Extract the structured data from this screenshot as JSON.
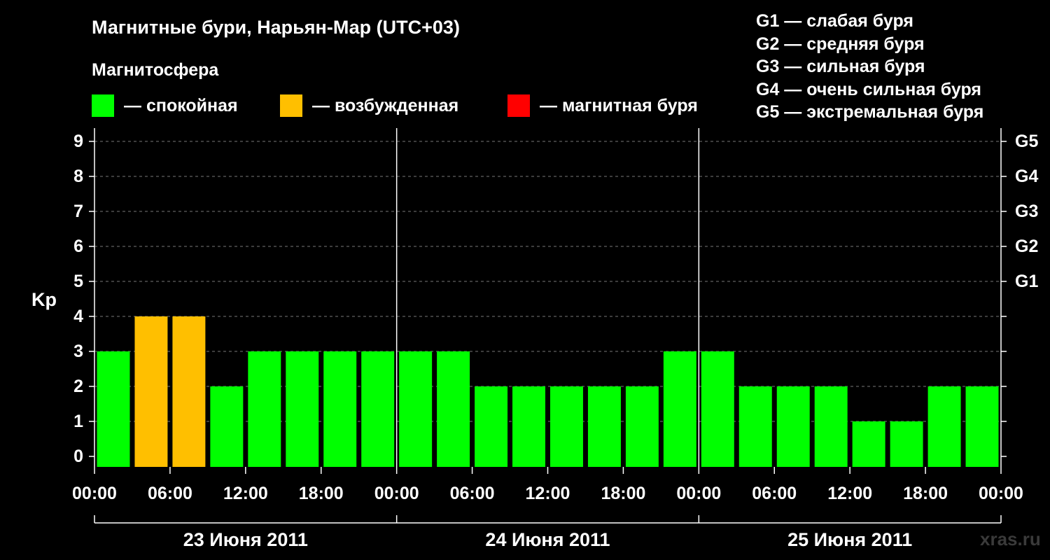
{
  "header": {
    "title": "Магнитные бури, Нарьян-Мар (UTC+03)",
    "subtitle": "Магнитосфера"
  },
  "legend": [
    {
      "label": "— спокойная",
      "color": "#00ff00"
    },
    {
      "label": "— возбужденная",
      "color": "#ffbf00"
    },
    {
      "label": "— магнитная буря",
      "color": "#ff0000"
    }
  ],
  "g_legend": [
    "G1 — слабая буря",
    "G2 — средняя буря",
    "G3 — сильная буря",
    "G4 — очень сильная буря",
    "G5 — экстремальная буря"
  ],
  "watermark": "xras.ru",
  "chart_data": {
    "type": "bar",
    "ylabel": "Kp",
    "ylim": [
      0,
      9
    ],
    "yticks": [
      "0",
      "1",
      "2",
      "3",
      "4",
      "5",
      "6",
      "7",
      "8",
      "9"
    ],
    "right_ticks": [
      {
        "kp": 5,
        "label": "G1"
      },
      {
        "kp": 6,
        "label": "G2"
      },
      {
        "kp": 7,
        "label": "G3"
      },
      {
        "kp": 8,
        "label": "G4"
      },
      {
        "kp": 9,
        "label": "G5"
      }
    ],
    "xtick_labels": [
      "00:00",
      "06:00",
      "12:00",
      "18:00",
      "00:00",
      "06:00",
      "12:00",
      "18:00",
      "00:00",
      "06:00",
      "12:00",
      "18:00",
      "00:00"
    ],
    "days": [
      "23 Июня 2011",
      "24 Июня 2011",
      "25 Июня 2011"
    ],
    "interval_hours": 3,
    "values": [
      3,
      4,
      4,
      2,
      3,
      3,
      3,
      3,
      3,
      3,
      2,
      2,
      2,
      2,
      2,
      3,
      3,
      2,
      2,
      2,
      1,
      1,
      2,
      2
    ],
    "colors": [
      "#00ff00",
      "#ffbf00",
      "#ffbf00",
      "#00ff00",
      "#00ff00",
      "#00ff00",
      "#00ff00",
      "#00ff00",
      "#00ff00",
      "#00ff00",
      "#00ff00",
      "#00ff00",
      "#00ff00",
      "#00ff00",
      "#00ff00",
      "#00ff00",
      "#00ff00",
      "#00ff00",
      "#00ff00",
      "#00ff00",
      "#00ff00",
      "#00ff00",
      "#00ff00",
      "#00ff00"
    ],
    "grid": "dashed at each Kp level"
  }
}
